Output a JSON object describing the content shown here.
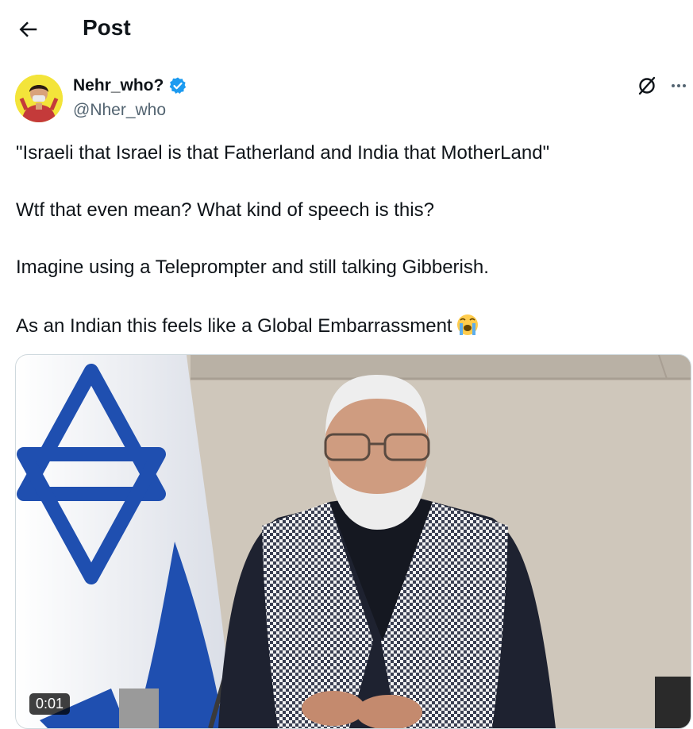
{
  "header": {
    "title": "Post"
  },
  "author": {
    "name": "Nehr_who?",
    "handle": "@Nher_who"
  },
  "tweet": {
    "lines": [
      "\"Israeli that Israel is that Fatherland and India that MotherLand\"",
      "Wtf that even mean? What kind of speech is this?",
      "Imagine using a Teleprompter and still talking Gibberish.",
      "As an Indian this feels like a Global Embarrassment"
    ]
  },
  "media": {
    "timestamp": "0:01"
  },
  "colors": {
    "verified": "#1d9bf0",
    "text": "#0f1419",
    "secondary": "#536471"
  },
  "icons": [
    "back-arrow-icon",
    "verified-badge-icon",
    "grok-icon",
    "more-icon",
    "loudly-crying-face-emoji"
  ]
}
